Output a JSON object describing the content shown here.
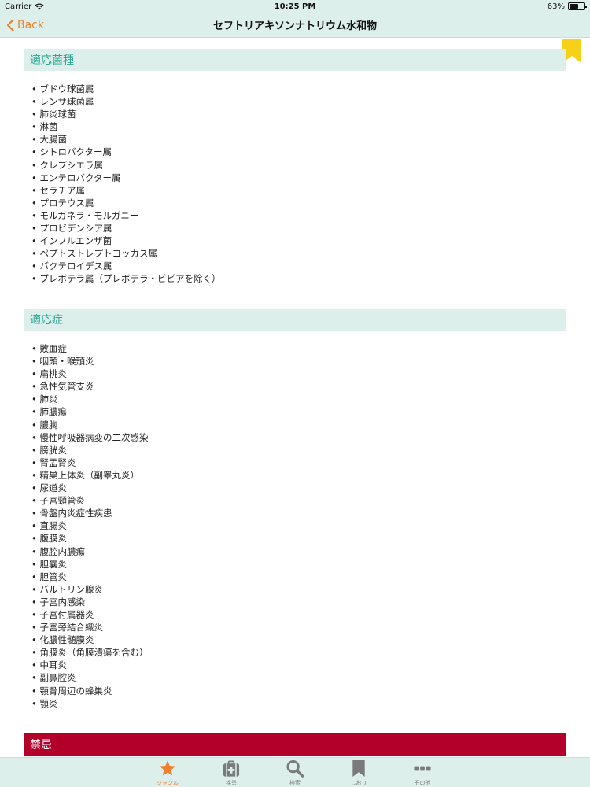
{
  "status_bar": {
    "carrier": "Carrier",
    "time": "10:25 PM",
    "battery_percent": "63%",
    "battery_level": 0.63
  },
  "nav": {
    "back_label": "Back",
    "title": "セフトリアキソンナトリウム水和物"
  },
  "sections": {
    "bacteria": {
      "title": "適応菌種",
      "items": [
        "ブドウ球菌属",
        "レンサ球菌属",
        "肺炎球菌",
        "淋菌",
        "大腸菌",
        "シトロバクター属",
        "クレブシエラ属",
        "エンテロバクター属",
        "セラチア属",
        "プロテウス属",
        "モルガネラ・モルガニー",
        "プロビデンシア属",
        "インフルエンザ菌",
        "ペプトストレプトコッカス属",
        "バクテロイデス属",
        "プレボテラ属（プレボテラ・ビビアを除く）"
      ]
    },
    "indications": {
      "title": "適応症",
      "items": [
        "敗血症",
        "咽頭・喉頭炎",
        "扁桃炎",
        "急性気管支炎",
        "肺炎",
        "肺膿瘍",
        "膿胸",
        "慢性呼吸器病変の二次感染",
        "膀胱炎",
        "腎盂腎炎",
        "精巣上体炎（副睾丸炎）",
        "尿道炎",
        "子宮頸管炎",
        "骨盤内炎症性疾患",
        "直腸炎",
        "腹膜炎",
        "腹腔内膿瘍",
        "胆嚢炎",
        "胆管炎",
        "バルトリン腺炎",
        "子宮内感染",
        "子宮付属器炎",
        "子宮旁結合織炎",
        "化膿性髄膜炎",
        "角膜炎（角膜潰瘍を含む）",
        "中耳炎",
        "副鼻腔炎",
        "顎骨周辺の蜂巣炎",
        "顎炎"
      ]
    },
    "contraindications": {
      "title": "禁忌"
    }
  },
  "tabs": [
    {
      "label": "ジャンル",
      "icon": "star-icon",
      "active": true
    },
    {
      "label": "疾患",
      "icon": "medical-kit-icon",
      "active": false
    },
    {
      "label": "検索",
      "icon": "magnifier-icon",
      "active": false
    },
    {
      "label": "しおり",
      "icon": "bookmark-icon",
      "active": false
    },
    {
      "label": "その他",
      "icon": "more-dots-icon",
      "active": false
    }
  ],
  "colors": {
    "bar_background": "#dcefeb",
    "accent_orange": "#f07f2e",
    "section_title_teal": "#2aa593",
    "danger_red": "#b3002a",
    "bookmark_yellow": "#f7d117"
  }
}
